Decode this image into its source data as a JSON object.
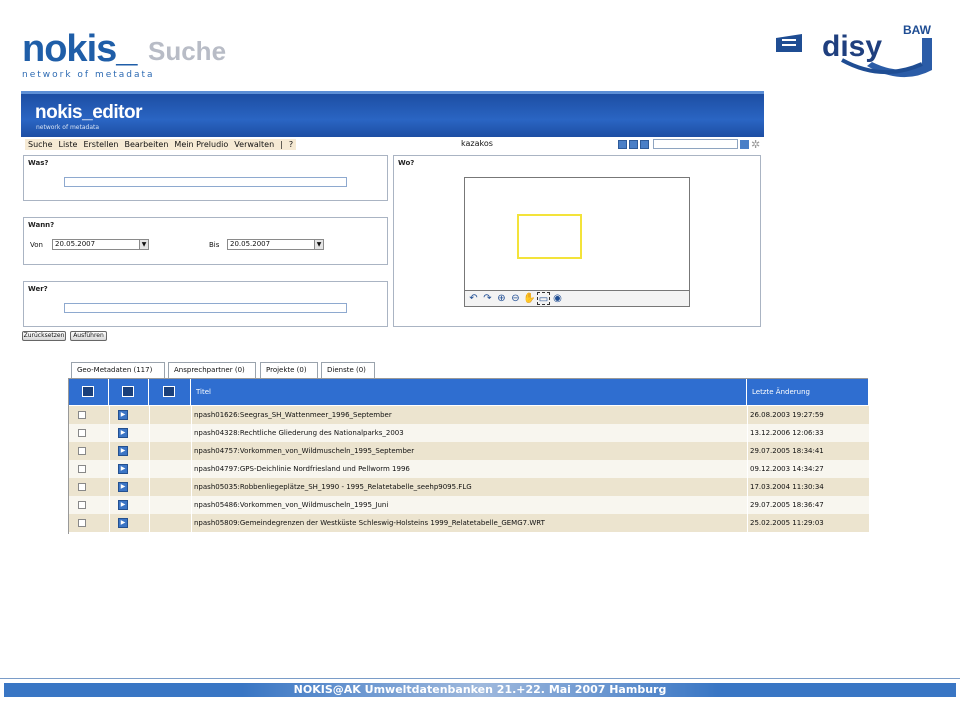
{
  "logo": {
    "name_part1": "nok",
    "name_i": "i",
    "name_part2": "s_",
    "page_title": "Suche",
    "subtitle": "network of metadata"
  },
  "partner": {
    "disy": "disy",
    "baw": "BAW"
  },
  "app": {
    "title": "nokis_editor",
    "subtitle": "network of metadata"
  },
  "menu": [
    "Suche",
    "Liste",
    "Erstellen",
    "Bearbeiten",
    "Mein Preludio",
    "Verwalten",
    "|",
    "?"
  ],
  "user": "kazakos",
  "search": {
    "was_label": "Was?",
    "wann_label": "Wann?",
    "von_label": "Von",
    "von_value": "20.05.2007",
    "bis_label": "Bis",
    "bis_value": "20.05.2007",
    "wer_label": "Wer?",
    "wo_label": "Wo?",
    "reset_label": "Zurücksetzen",
    "run_label": "Ausführen"
  },
  "tabs": [
    "Geo-Metadaten (117)",
    "Ansprechpartner (0)",
    "Projekte (0)",
    "Dienste (0)"
  ],
  "table": {
    "headers": {
      "title": "Titel",
      "changed": "Letzte Änderung"
    },
    "rows": [
      {
        "title": "npash01626:Seegras_SH_Wattenmeer_1996_September",
        "changed": "26.08.2003 19:27:59"
      },
      {
        "title": "npash04328:Rechtliche Gliederung des Nationalparks_2003",
        "changed": "13.12.2006 12:06:33"
      },
      {
        "title": "npash04757:Vorkommen_von_Wildmuscheln_1995_September",
        "changed": "29.07.2005 18:34:41"
      },
      {
        "title": "npash04797:GPS-Deichlinie Nordfriesland und Pellworm 1996",
        "changed": "09.12.2003 14:34:27"
      },
      {
        "title": "npash05035:Robbenliegeplätze_SH_1990 - 1995_Relatetabelle_seehp9095.FLG",
        "changed": "17.03.2004 11:30:34"
      },
      {
        "title": "npash05486:Vorkommen_von_Wildmuscheln_1995_Juni",
        "changed": "29.07.2005 18:36:47"
      },
      {
        "title": "npash05809:Gemeindegrenzen der Westküste Schleswig-Holsteins 1999_Relatetabelle_GEMG7.WRT",
        "changed": "25.02.2005 11:29:03"
      }
    ]
  },
  "footer": "NOKIS@AK Umweltdatenbanken 21.+22. Mai 2007 Hamburg",
  "colors": {
    "brand": "#1f5ea8",
    "header_blue": "#2f6ed0",
    "row_odd": "#ece4cf",
    "highlight": "#f3e33a"
  }
}
